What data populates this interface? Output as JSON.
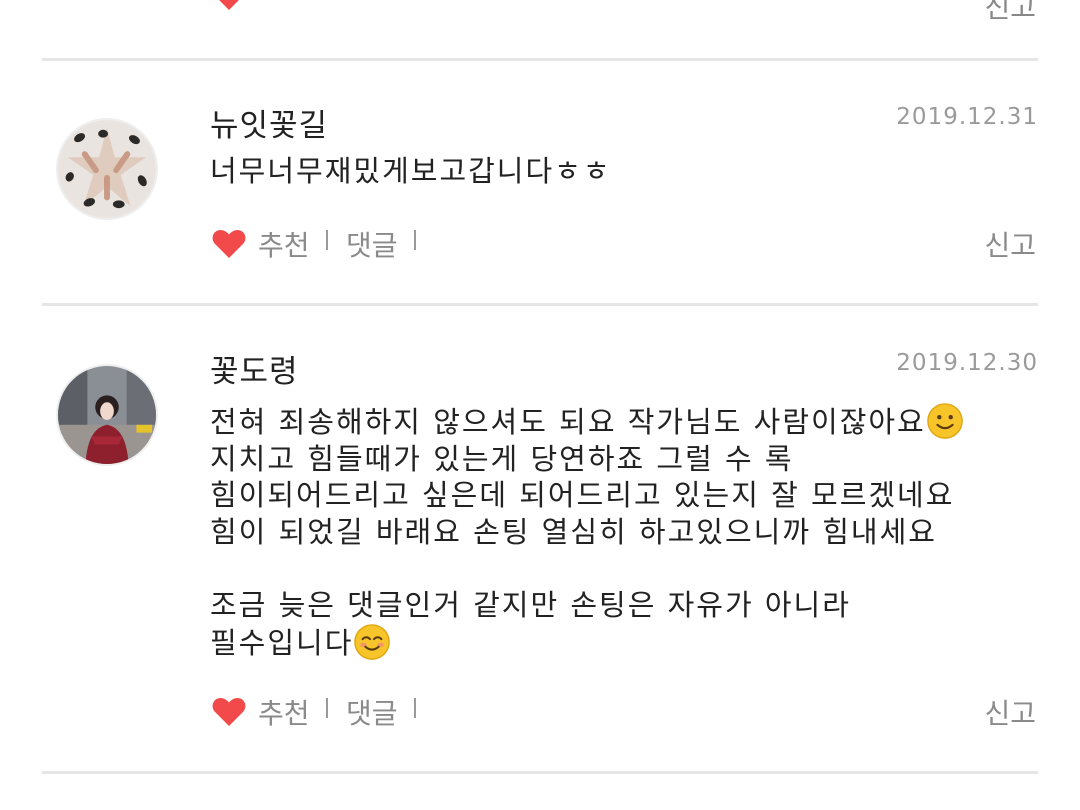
{
  "colors": {
    "heart": "#f24a4a",
    "divider": "#e6e6e6",
    "meta_text": "#8a8a8a"
  },
  "actions": {
    "recommend_label": "추천",
    "reply_label": "댓글",
    "report_label": "신고"
  },
  "comments": [
    {
      "author": "뉴잇꽃길",
      "date": "2019.12.31",
      "lines": [
        "너무너무재밌게보고갑니다ㅎㅎ"
      ]
    },
    {
      "author": "꽃도령",
      "date": "2019.12.30",
      "lines": [
        "전혀 죄송해하지 않으셔도 되요 작가님도 사람이잖아요",
        "지치고 힘들때가 있는게 당연하죠 그럴 수 록",
        "힘이되어드리고 싶은데 되어드리고 있는지 잘 모르겠네요",
        "힘이 되었길 바래요 손팅 열심히 하고있으니까 힘내세요",
        "",
        "조금 늦은 댓글인거 같지만 손팅은 자유가 아니라",
        "필수입니다"
      ],
      "emojis": [
        "smiling-face-emoji",
        "blushing-face-emoji"
      ]
    }
  ]
}
